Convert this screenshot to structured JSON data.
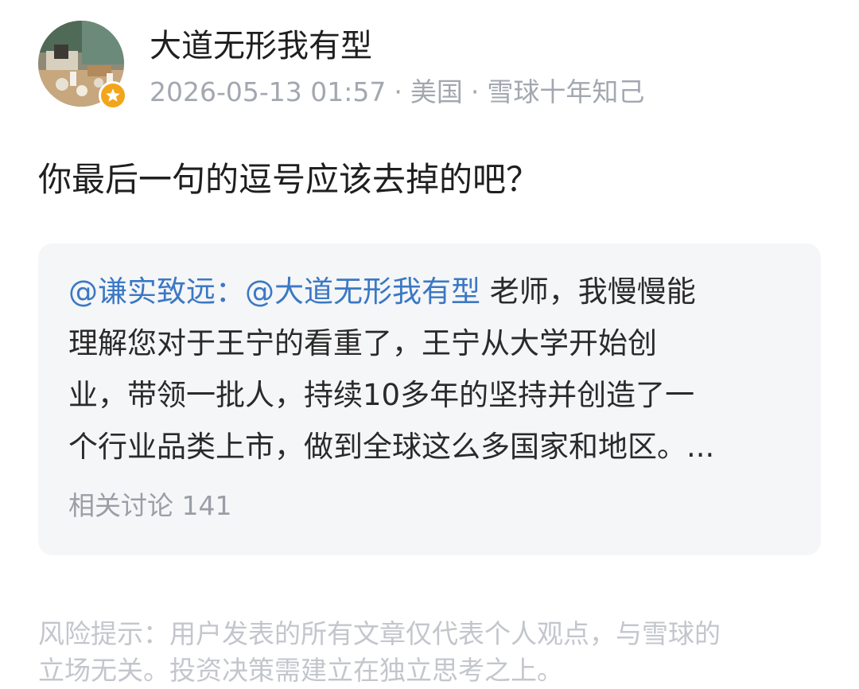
{
  "header": {
    "avatar_icon": "user-avatar-photo",
    "badge_icon": "star-badge-icon",
    "badge_color": "#f2a51b",
    "username": "大道无形我有型",
    "timestamp": "2026-05-13 01:57",
    "separator": "·",
    "location": "美国",
    "tenure_badge": "雪球十年知己"
  },
  "post": {
    "text": "你最后一句的逗号应该去掉的吧？"
  },
  "quote": {
    "mention_author": "@谦实致远：",
    "mention_target": "@大道无形我有型",
    "lines": [
      " 老师，我慢慢能",
      "理解您对于王宁的看重了，王宁从大学开始创",
      "业，带领一批人，持续10多年的坚持并创造了一",
      "个行业品类上市，做到全球这么多国家和地区。..."
    ],
    "related_label": "相关讨论",
    "related_count": "141",
    "mention_color": "#3b78c4"
  },
  "disclaimer": {
    "line1": "风险提示：用户发表的所有文章仅代表个人观点，与雪球的",
    "line2": "立场无关。投资决策需建立在独立思考之上。"
  }
}
